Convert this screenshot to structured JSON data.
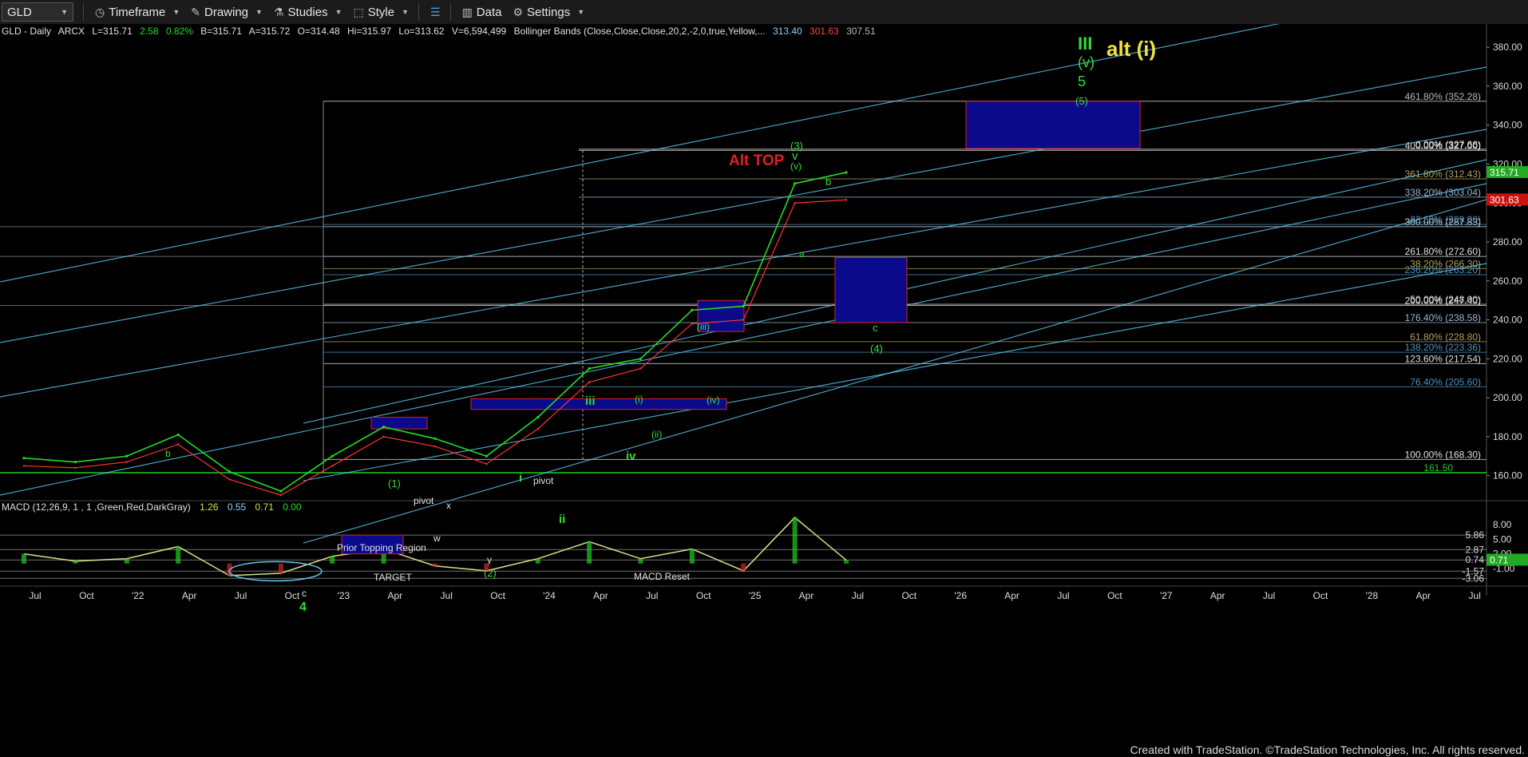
{
  "toolbar": {
    "symbol": "GLD",
    "timeframe": "Timeframe",
    "drawing": "Drawing",
    "studies": "Studies",
    "style": "Style",
    "data": "Data",
    "settings": "Settings"
  },
  "header": {
    "instrument": "GLD - Daily",
    "exchange": "ARCX",
    "last": "L=315.71",
    "change": "2.58",
    "change_pct": "0.82%",
    "bid": "B=315.71",
    "ask": "A=315.72",
    "open": "O=314.48",
    "high": "Hi=315.97",
    "low": "Lo=313.62",
    "volume": "V=6,594,499",
    "study": "Bollinger Bands (Close,Close,Close,20,2,-2,0,true,Yellow,...",
    "bb_upper": "313.40",
    "bb_lower": "301.63",
    "bb_mid": "307.51"
  },
  "macd_header": {
    "label": "MACD (12,26,9, 1 , 1 ,Green,Red,DarkGray)",
    "v1": "1.26",
    "v2": "0.55",
    "v3": "0.71",
    "v4": "0.00"
  },
  "price_axis": {
    "ticks": [
      "380.00",
      "360.00",
      "340.00",
      "320.00",
      "300.00",
      "280.00",
      "260.00",
      "240.00",
      "220.00",
      "200.00",
      "180.00",
      "160.00"
    ],
    "last_price": "315.71",
    "bb_upper_tag": "313.40",
    "bb_lower_tag": "301.63"
  },
  "macd_axis": {
    "ticks": [
      "8.00",
      "5.00",
      "2.00",
      "-1.00"
    ],
    "levels": [
      "5.86",
      "2.87",
      "0.74",
      "-1.57",
      "-3.06"
    ],
    "last_value": "0.71"
  },
  "time_axis": [
    "Jul",
    "Oct",
    "'22",
    "Apr",
    "Jul",
    "Oct",
    "'23",
    "Apr",
    "Jul",
    "Oct",
    "'24",
    "Apr",
    "Jul",
    "Oct",
    "'25",
    "Apr",
    "Jul",
    "Oct",
    "'26",
    "Apr",
    "Jul",
    "Oct",
    "'27",
    "Apr",
    "Jul",
    "Oct",
    "'28",
    "Apr",
    "Jul"
  ],
  "fib_levels": [
    {
      "label": "461.80% (352.28)",
      "price": 352.28,
      "color": "#b9b9b9"
    },
    {
      "label": "400.00% (327.00)",
      "price": 327.0,
      "color": "#e0e0e0"
    },
    {
      "label": "0.00% (327.66)",
      "price": 327.66,
      "color": "#e0e0e0"
    },
    {
      "label": "361.80% (312.43)",
      "price": 312.43,
      "color": "#b2a35a"
    },
    {
      "label": "338.20% (303.04)",
      "price": 303.04,
      "color": "#9ab6d6"
    },
    {
      "label": "300.00% (287.83)",
      "price": 287.83,
      "color": "#e0e0e0"
    },
    {
      "label": "23.60% (289.00)",
      "price": 289.0,
      "color": "#4e8fbf"
    },
    {
      "label": "261.80% (272.60)",
      "price": 272.6,
      "color": "#e0e0e0"
    },
    {
      "label": "38.20% (266.30)",
      "price": 266.3,
      "color": "#b2a35a"
    },
    {
      "label": "236.20% (263.20)",
      "price": 263.2,
      "color": "#4e8fbf"
    },
    {
      "label": "200.00% (247.40)",
      "price": 247.4,
      "color": "#e0e0e0"
    },
    {
      "label": "50.00% (248.00)",
      "price": 248.0,
      "color": "#cfcfcf"
    },
    {
      "label": "176.40% (238.58)",
      "price": 238.58,
      "color": "#9ab6d6"
    },
    {
      "label": "61.80% (228.80)",
      "price": 228.8,
      "color": "#b2a35a"
    },
    {
      "label": "138.20% (223.36)",
      "price": 223.36,
      "color": "#4e8fbf"
    },
    {
      "label": "123.60% (217.54)",
      "price": 217.54,
      "color": "#e0e0e0"
    },
    {
      "label": "76.40% (205.60)",
      "price": 205.6,
      "color": "#4e8fbf"
    },
    {
      "label": "100.00% (168.30)",
      "price": 168.3,
      "color": "#e0e0e0"
    },
    {
      "label": "161.50",
      "price": 161.5,
      "color": "#22cc22"
    }
  ],
  "annotations": {
    "III": "III",
    "alt_i": "alt (i)",
    "v_top": "(v)",
    "five": "5",
    "five_paren": "(5)",
    "three_paren": "(3)",
    "v": "v",
    "v_paren": "(v)",
    "alt_top": "Alt TOP",
    "b_top": "b",
    "a": "a",
    "c": "c",
    "four_paren": "(4)",
    "iii": "(iii)",
    "iv_paren": "(iv)",
    "i_paren": "(i)",
    "ii_paren": "(ii)",
    "iii_big": "iii",
    "iv": "iv",
    "i_green": "i",
    "ii": "ii",
    "pivot1": "pivot",
    "pivot2": "pivot",
    "one_paren": "(1)",
    "two_paren": "(2)",
    "w": "w",
    "x": "x",
    "y": "y",
    "b_left": "b",
    "c_left": "c",
    "four": "4",
    "prior_topping": "Prior Topping Region",
    "target": "TARGET",
    "macd_reset": "MACD Reset"
  },
  "footer": "Created with TradeStation. ©TradeStation Technologies, Inc. All rights reserved.",
  "chart_data": {
    "type": "line",
    "title": "GLD - Daily",
    "ylim": [
      150,
      385
    ],
    "macd_ylim": [
      -4,
      10.5
    ],
    "x": [
      "Jul '21",
      "Oct '21",
      "Jan '22",
      "Mar '22",
      "Jul '22",
      "Oct '22",
      "Jan '23",
      "Apr '23",
      "Jul '23",
      "Oct '23",
      "Jan '24",
      "Apr '24",
      "Jul '24",
      "Oct '24",
      "Jan '25",
      "Apr '25",
      "Jul '25"
    ],
    "series": [
      {
        "name": "GLD",
        "color": "#22dd22",
        "values": [
          169,
          167,
          170,
          181,
          162,
          152,
          170,
          185,
          179,
          170,
          190,
          215,
          220,
          245,
          247,
          310,
          315.71
        ]
      },
      {
        "name": "Bollinger Bands",
        "color": "#ff3333",
        "values": [
          165,
          164,
          167,
          176,
          158,
          150,
          165,
          180,
          175,
          166,
          184,
          208,
          215,
          238,
          240,
          300,
          301.63
        ]
      }
    ],
    "macd": {
      "name": "MACD",
      "color": "#dddd88",
      "values": [
        2.0,
        0.5,
        1.0,
        3.5,
        -2.5,
        -2.0,
        1.5,
        3.0,
        -0.5,
        -1.5,
        1.0,
        4.5,
        1.0,
        3.0,
        -1.5,
        9.5,
        0.71
      ]
    },
    "grid": false
  }
}
